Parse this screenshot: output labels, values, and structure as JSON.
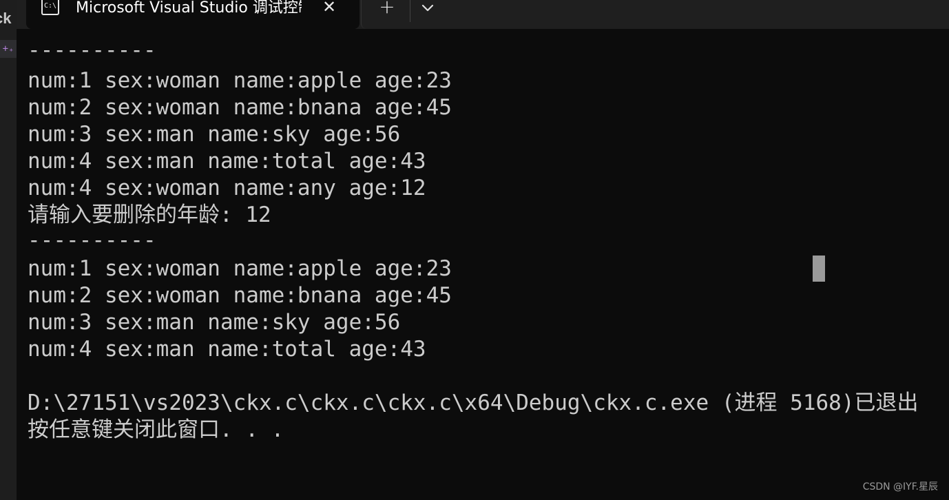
{
  "background_window": {
    "partial_text": "ck"
  },
  "tab": {
    "icon_text": "C:\\",
    "title": "Microsoft Visual Studio 调试控制台",
    "close_glyph": "✕"
  },
  "tabbar": {
    "new_tab_glyph": "+",
    "dropdown_icon": "chevron-down-icon"
  },
  "terminal": {
    "lines": [
      "----------",
      "num:1 sex:woman name:apple age:23",
      "num:2 sex:woman name:bnana age:45",
      "num:3 sex:man name:sky age:56",
      "num:4 sex:man name:total age:43",
      "num:4 sex:woman name:any age:12",
      "请输入要删除的年龄: 12",
      "----------",
      "num:1 sex:woman name:apple age:23",
      "num:2 sex:woman name:bnana age:45",
      "num:3 sex:man name:sky age:56",
      "num:4 sex:man name:total age:43",
      "",
      "D:\\27151\\vs2023\\ckx.c\\ckx.c\\ckx.c\\x64\\Debug\\ckx.c.exe (进程 5168)已退出",
      "按任意键关闭此窗口. . ."
    ]
  },
  "watermark": "CSDN @IYF.星辰",
  "colors": {
    "background": "#0c0c0c",
    "text": "#cccccc",
    "tabbar": "#1f1f1f",
    "cursor": "#9a9a9a"
  }
}
